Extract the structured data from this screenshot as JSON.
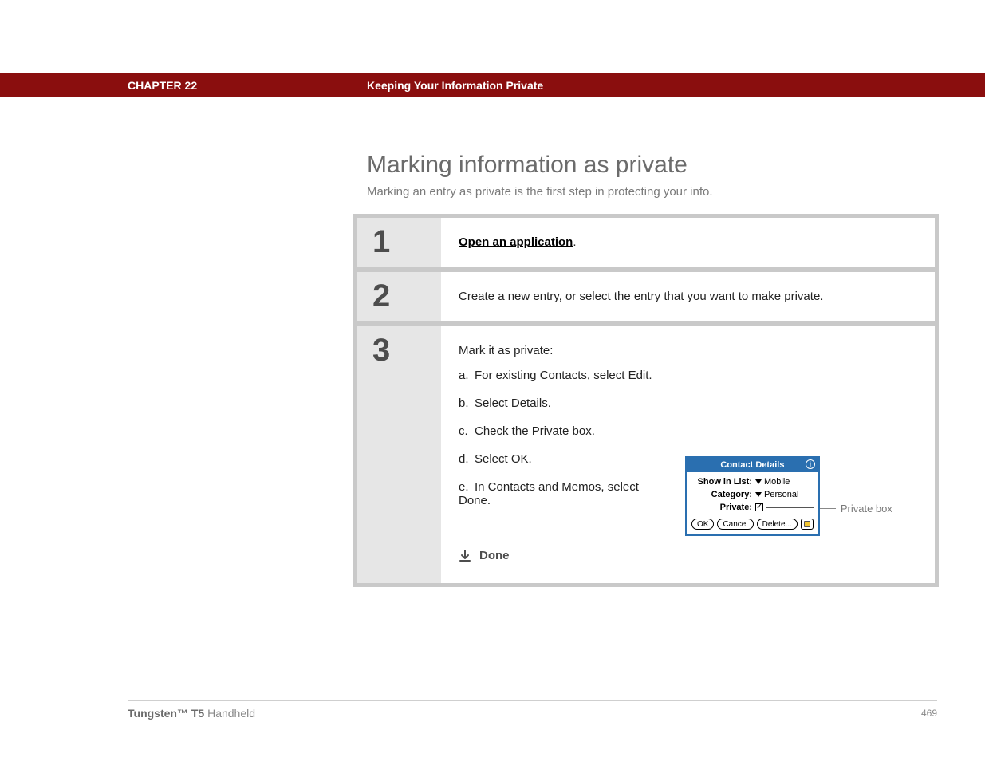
{
  "header": {
    "chapter": "CHAPTER 22",
    "title": "Keeping Your Information Private"
  },
  "main": {
    "heading": "Marking information as private",
    "subheading": "Marking an entry as private is the first step in protecting your info."
  },
  "steps": [
    {
      "num": "1",
      "link_text": "Open an application",
      "suffix": "."
    },
    {
      "num": "2",
      "text": "Create a new entry, or select the entry that you want to make private."
    },
    {
      "num": "3",
      "intro": "Mark it as private:",
      "items": [
        {
          "marker": "a.",
          "text": "For existing Contacts, select Edit."
        },
        {
          "marker": "b.",
          "text": "Select Details."
        },
        {
          "marker": "c.",
          "text": "Check the Private box."
        },
        {
          "marker": "d.",
          "text": "Select OK."
        },
        {
          "marker": "e.",
          "text": "In Contacts and Memos, select Done."
        }
      ],
      "done_label": "Done",
      "figure": {
        "title": "Contact Details",
        "show_in_list_label": "Show in List:",
        "show_in_list_value": "Mobile",
        "category_label": "Category:",
        "category_value": "Personal",
        "private_label": "Private:",
        "private_check": "✓",
        "buttons": {
          "ok": "OK",
          "cancel": "Cancel",
          "delete": "Delete..."
        },
        "callout": "Private box"
      }
    }
  ],
  "footer": {
    "brand_strong": "Tungsten™ T5",
    "brand_rest": " Handheld",
    "page": "469"
  }
}
